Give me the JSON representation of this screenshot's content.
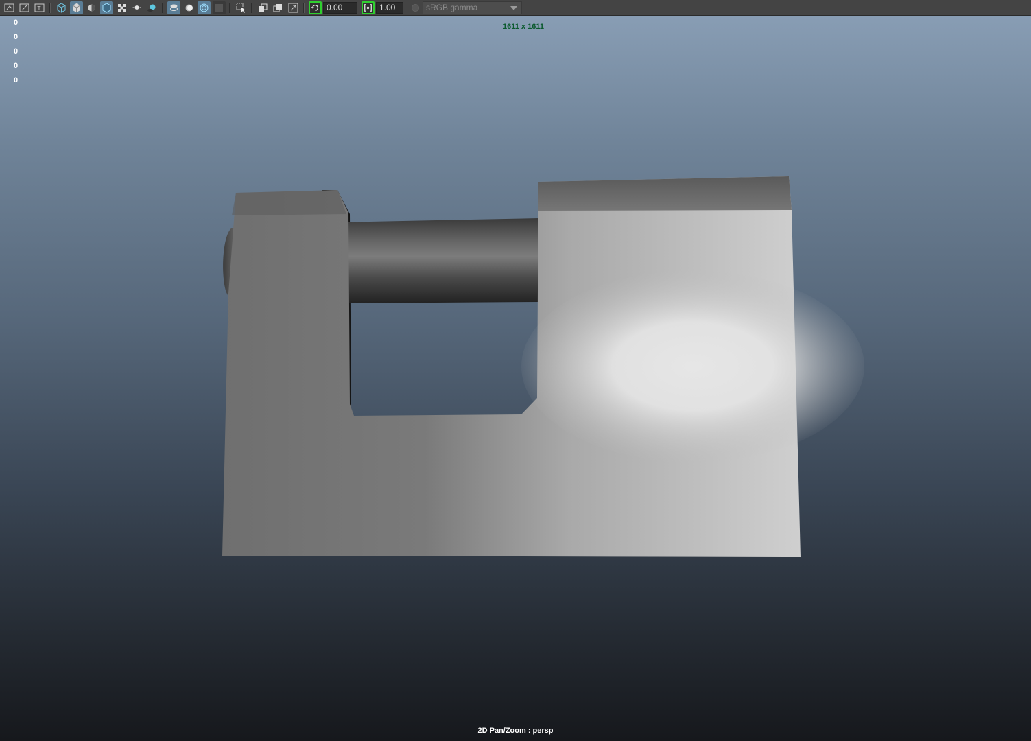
{
  "toolbar": {
    "icons": [
      "camera-attributes-icon",
      "image-plane-icon",
      "bookmark-icon",
      "wireframe-cube-icon",
      "smooth-shade-cube-icon",
      "default-lighting-icon",
      "wireframe-on-shaded-icon",
      "xray-checker-icon",
      "use-all-lights-icon",
      "shadows-icon",
      "isolate-select-icon",
      "xray-icon",
      "xray-joints-icon",
      "backface-icon",
      "select-camera-icon",
      "two-sided-lighting-icon",
      "copy-viewport-icon",
      "frame-all-icon"
    ],
    "exposure_value": "0.00",
    "gamma_value": "1.00",
    "color_space": "sRGB gamma"
  },
  "viewport": {
    "hud_counts": [
      "0",
      "0",
      "0",
      "0",
      "0"
    ],
    "resolution": "1611 x 1611",
    "mode_label": "2D Pan/Zoom : persp",
    "colors": {
      "background_top": "#889db4",
      "background_bottom": "#16181c",
      "resolution_text": "#0b5a2e",
      "body_gray": "#7a7a7a",
      "shackle_dark": "#303030"
    }
  }
}
